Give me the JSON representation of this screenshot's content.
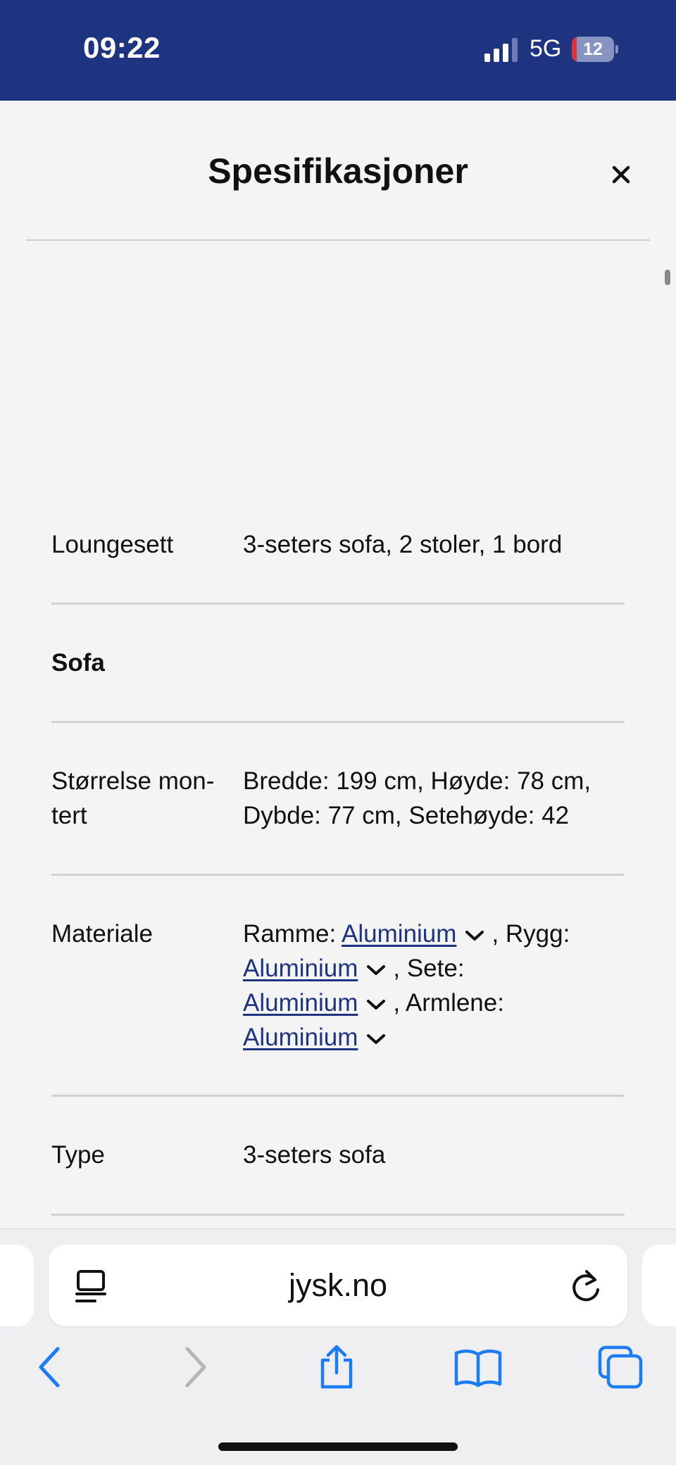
{
  "status_bar": {
    "time": "09:22",
    "network": "5G",
    "battery_level": "12",
    "battery_fraction": 0.12
  },
  "modal": {
    "title": "Spesifikasjoner",
    "close_icon": "close-icon"
  },
  "specs": {
    "loungesett": {
      "label": "Loungesett",
      "value": "3-seters sofa, 2 stoler, 1 bord"
    },
    "sofa_section": "Sofa",
    "size": {
      "label_line1": "Størrelse mon-",
      "label_line2": "tert",
      "value_line1": "Bredde: 199 cm, Høyde: 78 cm,",
      "value_line2": "Dybde: 77 cm, Setehøyde: 42"
    },
    "material": {
      "label": "Materiale",
      "frame_prefix": "Ramme: ",
      "frame_link": "Aluminium",
      "back_prefix": ", Rygg:",
      "back_link": "Aluminium",
      "seat_prefix": ", Sete:",
      "seat_link": "Aluminium",
      "armrest_prefix": ", Armlene:",
      "armrest_link": "Aluminium"
    },
    "type": {
      "label": "Type",
      "value": "3-seters sofa"
    }
  },
  "browser": {
    "url": "jysk.no",
    "icons": [
      "reader-mode-icon",
      "reload-icon",
      "back-icon",
      "forward-icon",
      "share-icon",
      "bookmarks-icon",
      "tabs-icon"
    ]
  },
  "colors": {
    "brand": "#1e3480",
    "link": "#1e3480",
    "ios_blue": "#1c7cf4",
    "battery_low": "#e0323a"
  }
}
